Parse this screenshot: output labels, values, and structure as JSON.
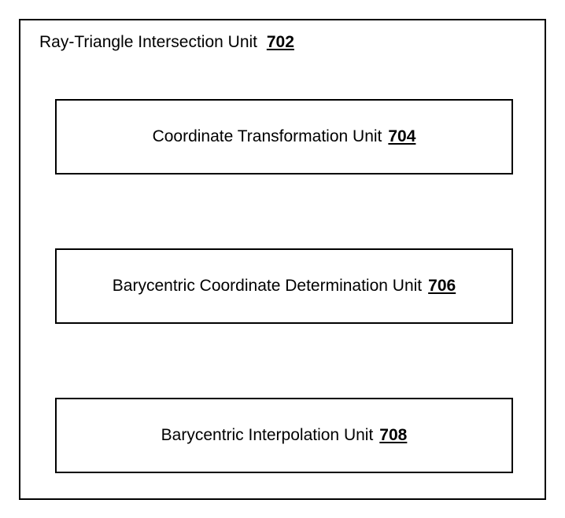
{
  "outer": {
    "label": "Ray-Triangle Intersection Unit",
    "ref": "702"
  },
  "boxes": [
    {
      "label": "Coordinate Transformation Unit",
      "ref": "704"
    },
    {
      "label": "Barycentric Coordinate Determination Unit",
      "ref": "706"
    },
    {
      "label": "Barycentric Interpolation Unit",
      "ref": "708"
    }
  ]
}
